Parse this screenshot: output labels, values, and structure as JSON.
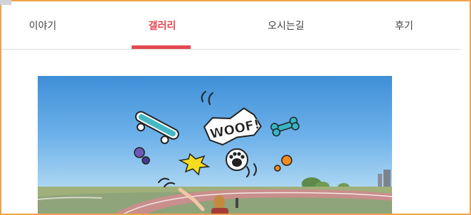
{
  "tabs": [
    {
      "label": "이야기",
      "active": false
    },
    {
      "label": "갤러리",
      "active": true
    },
    {
      "label": "오시는길",
      "active": false
    },
    {
      "label": "후기",
      "active": false
    }
  ],
  "accent_color": "#e4494f",
  "frame_color": "#f0a34e",
  "photo": {
    "sticker_text": "WOOF!",
    "stickers": [
      "skateboard-icon",
      "woof-sticker",
      "bone-icon",
      "dots-icon",
      "star-burst-icon",
      "paw-icon",
      "motion-lines-icon"
    ]
  }
}
